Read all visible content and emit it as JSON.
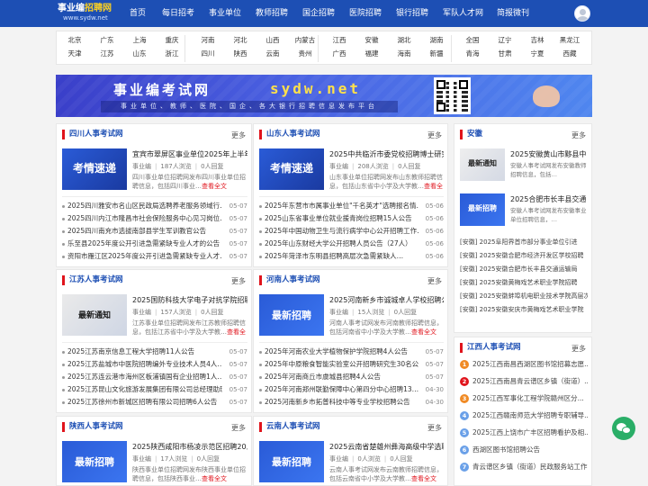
{
  "nav": {
    "logo_line1_a": "事业编",
    "logo_line1_b": "招聘网",
    "logo_line2": "www.sydw.net",
    "items": [
      "首页",
      "每日招考",
      "事业单位",
      "教师招聘",
      "国企招聘",
      "医院招聘",
      "银行招聘",
      "军队人才网",
      "简报微刊"
    ]
  },
  "regions": {
    "row1": [
      "北京",
      "广东",
      "上海",
      "重庆",
      "河南",
      "河北",
      "山西",
      "内蒙古",
      "江西",
      "安徽",
      "湖北",
      "湖南",
      "全国",
      "辽宁",
      "吉林",
      "黑龙江"
    ],
    "row2": [
      "天津",
      "江苏",
      "山东",
      "浙江",
      "四川",
      "陕西",
      "云南",
      "贵州",
      "广西",
      "福建",
      "海南",
      "新疆",
      "青海",
      "甘肃",
      "宁夏",
      "西藏"
    ]
  },
  "banner": {
    "title": "事业编考试网",
    "url": "sydw.net",
    "subtitle": "事业单位、教师、医院、国企、各大银行招聘信息发布平台"
  },
  "panels": [
    {
      "title": "四川人事考试网",
      "more": "更多",
      "thumb_text": "考情速递",
      "feature_title": "宜宾市翠屏区事业单位2025年上半年",
      "feature_meta": [
        "事业编",
        "187人浏览",
        "0人回复"
      ],
      "feature_desc": "四川事业单位招聘网发布四川事业单位招聘信息，包括四川事业…",
      "feature_more": "查看全文",
      "list": [
        {
          "t": "2025四川雅安市名山区民政局选聘养老服务领域行…",
          "d": "05-07"
        },
        {
          "t": "2025四川内江市隆昌市社会保险服务中心见习岗位…",
          "d": "05-07"
        },
        {
          "t": "2025四川南充市选拔南部县学生军训教官公告",
          "d": "05-07"
        },
        {
          "t": "乐至县2025年度公开引进急需紧缺专业人才的公告",
          "d": "05-07"
        },
        {
          "t": "资阳市雁江区2025年度公开引进急需紧缺专业人才…",
          "d": "05-07"
        }
      ]
    },
    {
      "title": "山东人事考试网",
      "more": "更多",
      "thumb_text": "考情速递",
      "feature_title": "2025中共临沂市委党校招聘博士研究",
      "feature_meta": [
        "事业编",
        "208人浏览",
        "0人回复"
      ],
      "feature_desc": "山东事业单位招聘网发布山东教师招聘信息，包括山东省中小学及大学教…",
      "feature_more": "查看全文",
      "list": [
        {
          "t": "2025年东营市市属事业单位\"千名英才\"选聘报名情…",
          "d": "05-06"
        },
        {
          "t": "2025山东省事业单位就业援青岗位招聘15人公告",
          "d": "05-06"
        },
        {
          "t": "2025年中国动物卫生与流行病学中心公开招聘工作…",
          "d": "05-06"
        },
        {
          "t": "2025年山东财经大学公开招聘人员公告（27人）",
          "d": "05-06"
        },
        {
          "t": "2025年菏泽市东明县招聘高层次急需紧缺人…",
          "d": "05-06"
        }
      ]
    },
    {
      "title": "江苏人事考试网",
      "more": "更多",
      "thumb_text": "最新通知",
      "feature_title": "2025国防科技大学电子对抗学院招聘",
      "feature_meta": [
        "事业编",
        "157人浏览",
        "0人回复"
      ],
      "feature_desc": "江苏事业单位招聘网发布江苏教师招聘信息，包括江苏省中小学及大学教…",
      "feature_more": "查看全文",
      "list": [
        {
          "t": "2025江苏南京信息工程大学招聘11人公告",
          "d": "05-07"
        },
        {
          "t": "2025江苏盐城市中医院招聘编外专业技术人员4人…",
          "d": "05-07"
        },
        {
          "t": "2025江苏连云港市海州区板浦镇国有企业招聘1人…",
          "d": "05-07"
        },
        {
          "t": "2025江苏昆山文化旅游发展集团有限公司总经理助理…",
          "d": "05-07"
        },
        {
          "t": "2025江苏徐州市新城区招聘有限公司招聘6人公告",
          "d": "05-07"
        }
      ]
    },
    {
      "title": "河南人事考试网",
      "more": "更多",
      "thumb_text": "最新招聘",
      "feature_title": "2025河南新乡市诚城卓人学校招聘公",
      "feature_meta": [
        "事业编",
        "15人浏览",
        "0人回复"
      ],
      "feature_desc": "河南人事考试网发布河南教师招聘信息，包括河南省中小学及大学教…",
      "feature_more": "查看全文",
      "list": [
        {
          "t": "2025年河南农业大学植物保护学院招聘4人公告",
          "d": "05-07"
        },
        {
          "t": "2025年中原粮食智能实验室公开招聘研究生30名公告",
          "d": "05-07"
        },
        {
          "t": "2025年河南商丘市虞城县招聘4人公告",
          "d": "05-07"
        },
        {
          "t": "2025年河南郑州联勤保障中心第四分中心招聘13…",
          "d": "04-30"
        },
        {
          "t": "2025河南新乡市拓普科技中等专业学校招聘公告",
          "d": "04-30"
        }
      ]
    },
    {
      "title": "陕西人事考试网",
      "more": "更多",
      "thumb_text": "最新招聘",
      "feature_title": "2025陕西咸阳市杨凌示范区招聘20人",
      "feature_meta": [
        "事业编",
        "17人浏览",
        "0人回复"
      ],
      "feature_desc": "陕西事业单位招聘网发布陕西事业单位招聘信息，包括陕西事业…",
      "feature_more": "查看全文"
    },
    {
      "title": "云南人事考试网",
      "more": "更多",
      "thumb_text": "最新招聘",
      "feature_title": "2025云南省楚雄州彝海高级中学选聘",
      "feature_meta": [
        "事业编",
        "0人浏览",
        "0人回复"
      ],
      "feature_desc": "云南人事考试网发布云南教师招聘信息，包括云南省中小学及大学教…",
      "feature_more": "查看全文"
    }
  ],
  "anhui": {
    "title": "安徽",
    "more": "更多",
    "cards": [
      {
        "thumb": "最新通知",
        "title": "2025安徽黄山市黟县中",
        "desc": "安徽人事考试网发布安徽教师招聘信息，包括…"
      },
      {
        "thumb": "最新招聘",
        "title": "2025合肥市长丰县交通",
        "desc": "安徽人事考试网发布安徽事业单位招聘信息，…"
      }
    ],
    "list": [
      "[安徽] 2025阜阳界首市部分事业单位引进",
      "[安徽] 2025安徽合肥市经济开发区学校招聘",
      "[安徽] 2025安徽合肥市长丰县交通运输局",
      "[安徽] 2025安徽黄梅戏艺术职业学院招聘",
      "[安徽] 2025安徽蚌埠机电职业技术学院高层次",
      "[安徽] 2025安徽安庆市黄梅戏艺术职业学院"
    ]
  },
  "jiangxi": {
    "title": "江西人事考试网",
    "more": "更多",
    "list": [
      "2025江西南昌西湖区图书馆招募志愿...",
      "2025江西南昌青云谱区乡镇（街道）...",
      "2025江西军事化工程学院赣州区分...",
      "2025江西赣南师范大学招聘专职辅导...",
      "2025江西上饶市广丰区招聘看护及相...",
      "西湖区图书馆招聘公告",
      "青云谱区乡镇（街道）民政服务站工作..."
    ],
    "num_colors": [
      "#f08a24",
      "#e0141c",
      "#f08a24",
      "#6aa0e8",
      "#6aa0e8",
      "#6aa0e8",
      "#6aa0e8"
    ]
  },
  "colors": {
    "nav": "#1d4fb4",
    "accent": "#e0141c",
    "link": "#1d4fb4",
    "wechat": "#2aae67"
  }
}
